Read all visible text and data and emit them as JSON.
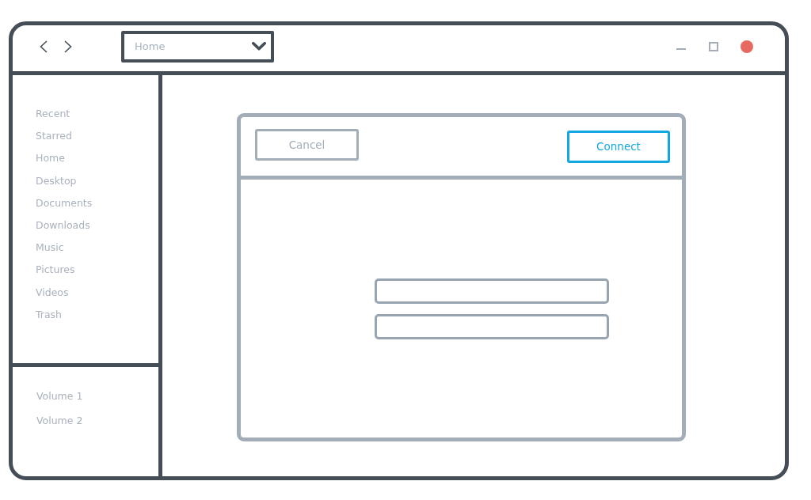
{
  "toolbar": {
    "location": {
      "value": "Home"
    }
  },
  "sidebar": {
    "places": [
      "Recent",
      "Starred",
      "Home",
      "Desktop",
      "Documents",
      "Downloads",
      "Music",
      "Pictures",
      "Videos",
      "Trash"
    ],
    "volumes": [
      "Volume 1",
      "Volume 2"
    ]
  },
  "dialog": {
    "buttons": [
      {
        "label": "Cancel",
        "kind": "secondary"
      },
      {
        "label": "Connect",
        "kind": "primary"
      }
    ],
    "fields": [
      {
        "kind": "text"
      },
      {
        "kind": "text"
      }
    ]
  }
}
